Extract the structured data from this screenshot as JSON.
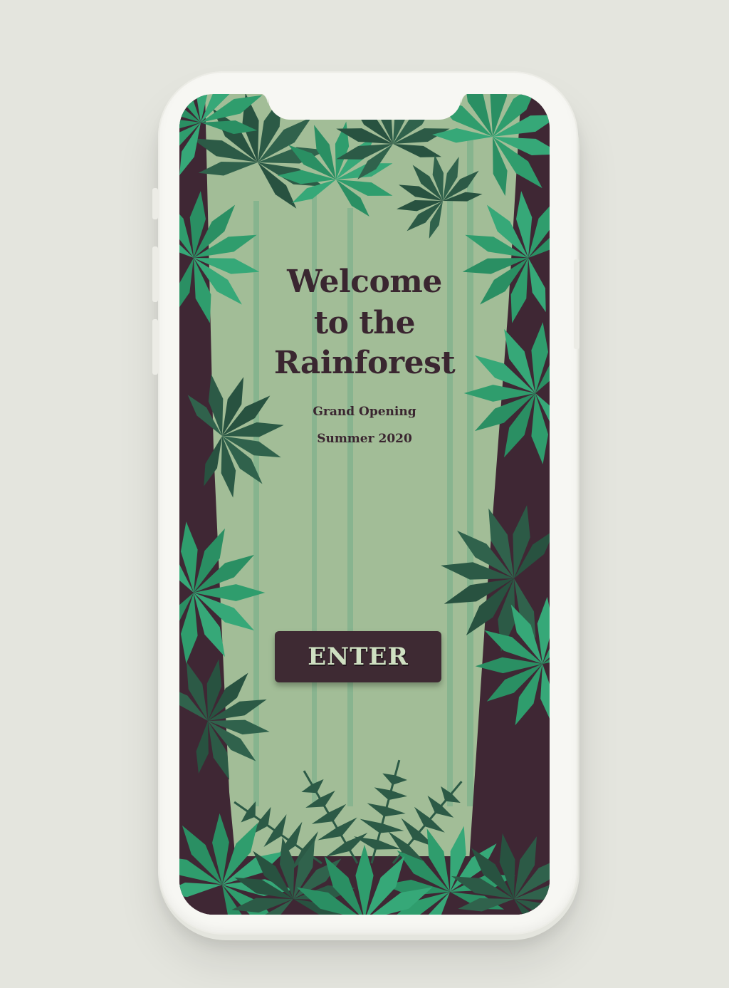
{
  "colors": {
    "page_bg": "#e4e5de",
    "phone_body": "#f7f7f3",
    "screen_bg": "#a2bd97",
    "trunk": "#3f2734",
    "leaf_bright": "#2f9d6d",
    "leaf_dark": "#2c5a46",
    "text_dark": "#3a2630",
    "button_bg": "#3e2a33",
    "button_text": "#cfe0c2"
  },
  "hero": {
    "title_line1": "Welcome",
    "title_line2": "to the",
    "title_line3": "Rainforest",
    "subtitle_line1": "Grand Opening",
    "subtitle_line2": "Summer 2020"
  },
  "cta": {
    "enter_label": "ENTER"
  },
  "illustration": {
    "icon": "rainforest-illustration"
  }
}
